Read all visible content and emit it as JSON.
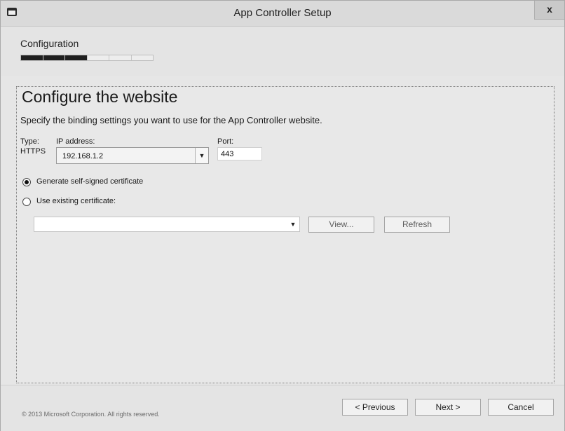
{
  "window": {
    "title": "App Controller Setup",
    "close_glyph": "x"
  },
  "header": {
    "stage": "Configuration",
    "progress_segments": 6,
    "progress_completed": 3
  },
  "content": {
    "title": "Configure the website",
    "description": "Specify the binding settings you want to use for the App Controller website.",
    "type_label": "Type:",
    "type_value": "HTTPS",
    "ip_label": "IP address:",
    "ip_value": "192.168.1.2",
    "port_label": "Port:",
    "port_value": "443",
    "radio_generate": "Generate self-signed certificate",
    "radio_existing": "Use existing certificate:",
    "selected_option": "generate",
    "certificate_value": "",
    "view_button": "View...",
    "refresh_button": "Refresh"
  },
  "footer": {
    "copyright": "© 2013 Microsoft Corporation. All rights reserved.",
    "previous_button": "< Previous",
    "next_button": "Next >",
    "cancel_button": "Cancel"
  },
  "icons": {
    "app": "window-icon",
    "close": "close-icon",
    "dropdown": "chevron-down-icon"
  }
}
